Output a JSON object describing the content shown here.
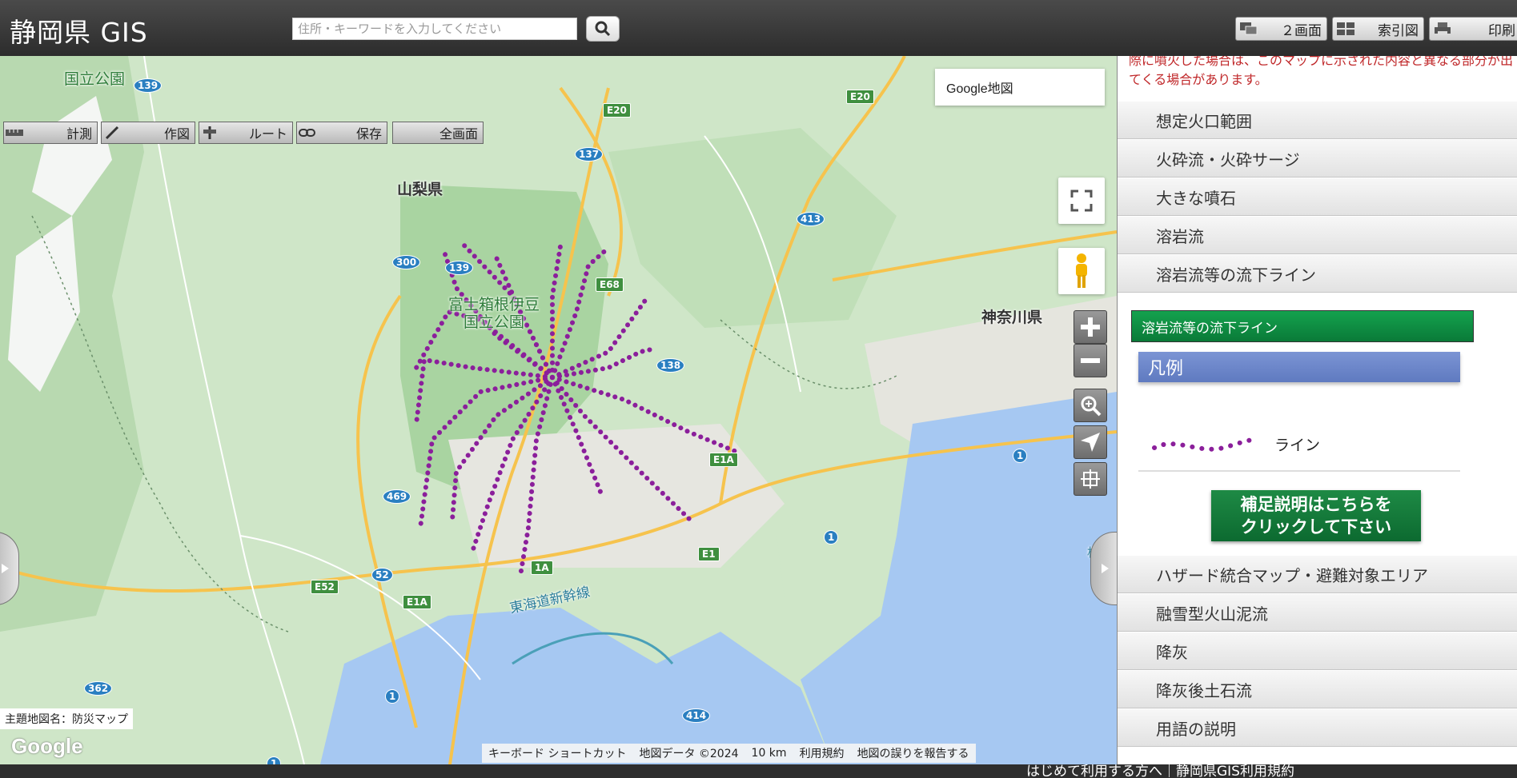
{
  "header": {
    "title": "静岡県 GIS",
    "search_placeholder": "住所・キーワードを入力してください",
    "buttons": {
      "two_screen": "２画面",
      "index_map": "索引図",
      "print": "印刷"
    }
  },
  "toolbar": {
    "measure": "計測",
    "draw": "作図",
    "route": "ルート",
    "save": "保存",
    "fullscreen": "全画面"
  },
  "map": {
    "map_type": "Google地図",
    "labels": {
      "yamanashi": "山梨県",
      "kanagawa": "神奈川県",
      "park": "富士箱根伊豆",
      "park2": "国立公園",
      "park_top": "国立公園",
      "shinkansen": "東海道新幹線",
      "sagami": "相模"
    },
    "road_shields": [
      "139",
      "E20",
      "137",
      "E20",
      "413",
      "300",
      "139",
      "E68",
      "138",
      "E1A",
      "469",
      "1",
      "E1",
      "1",
      "52",
      "E52",
      "E1A",
      "362",
      "1",
      "414",
      "1",
      "1A"
    ],
    "theme_label": "主題地図名：防災マップ",
    "google_logo": "Google",
    "attribution": {
      "shortcuts": "キーボード ショートカット",
      "data": "地図データ ©2024",
      "scale": "10 km",
      "terms": "利用規約",
      "report": "地図の誤りを報告する"
    }
  },
  "panel": {
    "notice": "際に噴火した場合は、このマップに示された内容と異なる部分が出てくる場合があります。",
    "items_top": [
      "想定火口範囲",
      "火砕流・火砕サージ",
      "大きな噴石",
      "溶岩流",
      "溶岩流等の流下ライン"
    ],
    "active_layer": "溶岩流等の流下ライン",
    "legend_title": "凡例",
    "legend_item": "ライン",
    "note_button": [
      "補足説明はこちらを",
      "クリックして下さい"
    ],
    "items_bottom": [
      "ハザード統合マップ・避難対象エリア",
      "融雪型火山泥流",
      "降灰",
      "降灰後土石流",
      "用語の説明"
    ],
    "colors": {
      "line": "#8b1f9b",
      "accent_green": "#0f8a45",
      "legend_blue": "#6a84c9",
      "notice_red": "#c0282a"
    }
  },
  "footer": {
    "text": "はじめて利用する方へ｜静岡県GIS利用規約"
  }
}
